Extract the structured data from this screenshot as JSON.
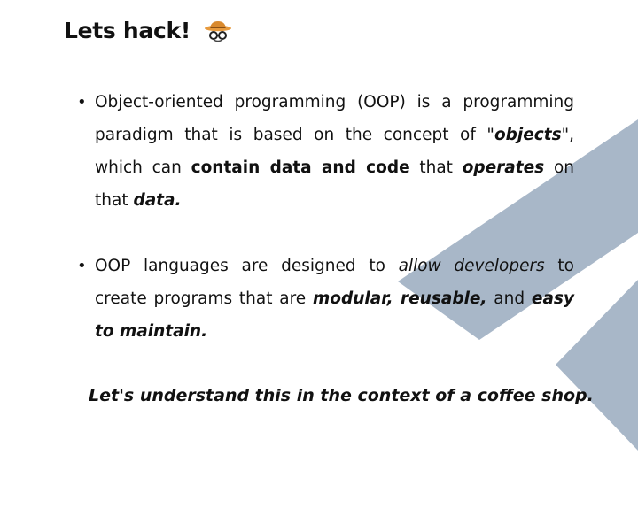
{
  "slide": {
    "title": "Lets hack!",
    "title_icon": "hacker-with-hat-icon",
    "colors": {
      "text": "#111111",
      "background": "#ffffff",
      "decoration": "#a8b7c8",
      "icon_hat": "#e79a3d",
      "icon_glasses": "#222222"
    },
    "bullets": [
      {
        "part1": "Object-oriented programming (OOP) is a programming paradigm that is based on the concept of \"",
        "objects": "objects",
        "part2": "\", which can ",
        "contain": "contain data and code",
        "part3": " that ",
        "operates": "operates",
        "part4": " on that ",
        "data": "data."
      },
      {
        "part1": "OOP languages are designed to ",
        "allow": "allow developers",
        "part2": " to create programs that are ",
        "modular": "modular, reusable,",
        "part3": " and ",
        "easy": "easy to maintain."
      }
    ],
    "closing": "Let's understand this in the context of a coffee shop."
  }
}
